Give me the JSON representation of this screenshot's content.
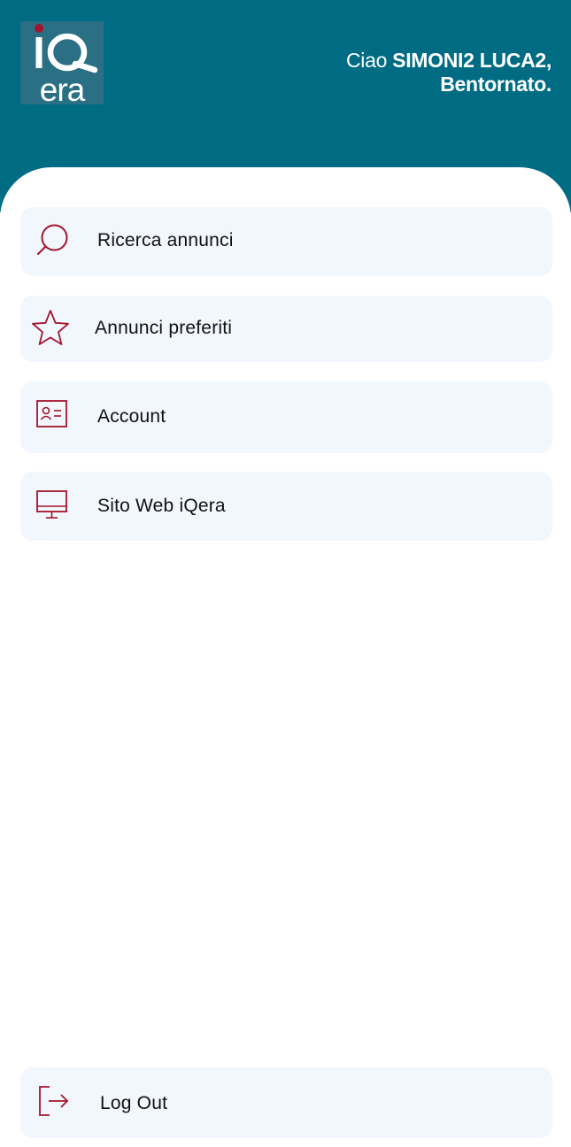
{
  "header": {
    "logo_text": "iQera",
    "greeting_prefix": "Ciao ",
    "user_name": "SIMONI2 LUCA2,",
    "welcome": "Bentornato."
  },
  "menu": {
    "items": [
      {
        "label": "Ricerca annunci",
        "icon": "search-icon"
      },
      {
        "label": "Annunci preferiti",
        "icon": "star-icon"
      },
      {
        "label": "Account",
        "icon": "id-card-icon"
      },
      {
        "label": "Sito Web iQera",
        "icon": "monitor-icon"
      }
    ],
    "logout": {
      "label": "Log Out",
      "icon": "logout-icon"
    }
  },
  "colors": {
    "header_bg": "#006c84",
    "card_bg": "#f2f7fd",
    "icon_accent": "#a3132b"
  }
}
